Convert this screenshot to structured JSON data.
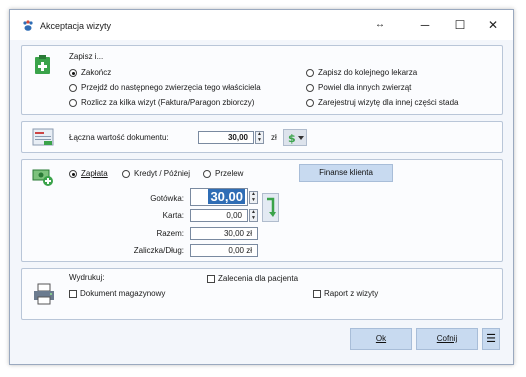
{
  "window": {
    "title": "Akceptacja wizyty",
    "resize_glyph": "↔",
    "minimize_glyph": "─",
    "maximize_glyph": "☐",
    "close_glyph": "✕"
  },
  "save_panel": {
    "heading": "Zapisz i...",
    "options": [
      {
        "label": "Zakończ",
        "selected": true
      },
      {
        "label": "Przejdź do następnego zwierzęcia tego właściciela",
        "selected": false
      },
      {
        "label": "Rozlicz za kilka wizyt (Faktura/Paragon zbiorczy)",
        "selected": false
      },
      {
        "label": "Zapisz do kolejnego lekarza",
        "selected": false
      },
      {
        "label": "Powiel dla innych zwierząt",
        "selected": false
      },
      {
        "label": "Zarejestruj wizytę dla innej części stada",
        "selected": false
      }
    ]
  },
  "total_panel": {
    "label": "Łączna wartość dokumentu:",
    "value": "30,00",
    "currency": "zł"
  },
  "payment_panel": {
    "methods": [
      {
        "label": "Zapłata",
        "selected": true
      },
      {
        "label": "Kredyt / Później",
        "selected": false
      },
      {
        "label": "Przelew",
        "selected": false
      }
    ],
    "finance_button": "Finanse klienta",
    "cash_label": "Gotówka:",
    "cash_value": "30,00",
    "card_label": "Karta:",
    "card_value": "0,00",
    "sum_label": "Razem:",
    "sum_value": "30,00 zł",
    "advance_label": "Zaliczka/Dług:",
    "advance_value": "0,00 zł"
  },
  "print_panel": {
    "heading": "Wydrukuj:",
    "checks": [
      {
        "label": "Zalecenia dla pacjenta",
        "checked": false
      },
      {
        "label": "Dokument magazynowy",
        "checked": false
      },
      {
        "label": "Raport z wizyty",
        "checked": false
      }
    ]
  },
  "footer": {
    "ok_label": "Ok",
    "cancel_label": "Cofnij",
    "menu_glyph": "☰"
  },
  "colors": {
    "accent": "#c8daf0",
    "icon_green": "#3aa34a",
    "border": "#b9c6d8"
  }
}
